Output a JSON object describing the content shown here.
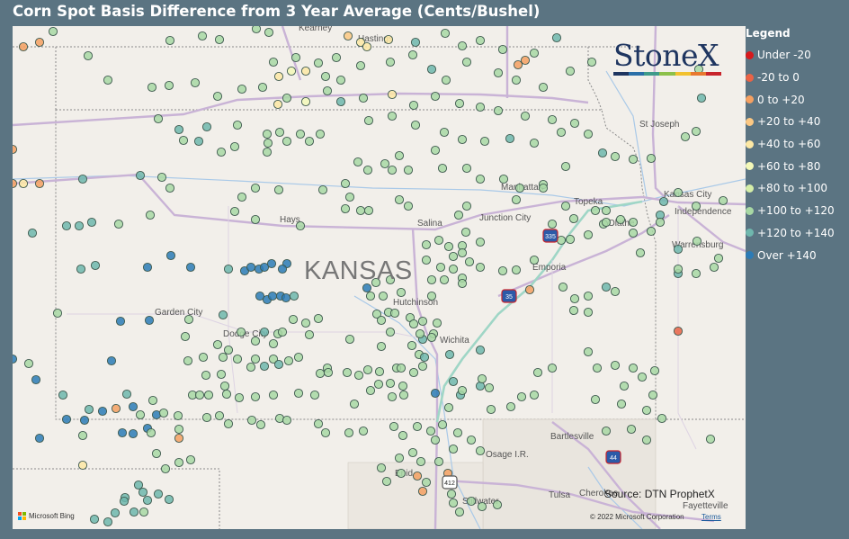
{
  "title": "Corn Spot Basis Difference from 3 Year Average (Cents/Bushel)",
  "map": {
    "state_label": "KANSAS",
    "source": "Source: DTN ProphetX",
    "copyright": "© 2022 Microsoft Corporation",
    "terms": "Terms",
    "bing": "Microsoft Bing",
    "logo": "StoneX",
    "logo_colors": [
      "#1e3560",
      "#2a6fa8",
      "#3f9b8a",
      "#8cc04a",
      "#f2c12e",
      "#e8782f",
      "#c8242c"
    ],
    "places": [
      "Kearney",
      "Hastings",
      "St Joseph",
      "Manhattan",
      "Topeka",
      "Kansas City",
      "Independence",
      "Hays",
      "Salina",
      "Junction City",
      "Olathe",
      "Warrensburg",
      "Emporia",
      "Garden City",
      "Hutchinson",
      "Dodge City",
      "Wichita",
      "Bartlesville",
      "Osage I.R.",
      "Enid",
      "Stillwater",
      "Tulsa",
      "Cherokee",
      "Fayetteville"
    ],
    "highway_shields": [
      "335",
      "35",
      "44",
      "412"
    ]
  },
  "legend": {
    "title": "Legend",
    "items": [
      {
        "label": "Under -20",
        "color": "#d7191c"
      },
      {
        "label": "-20 to 0",
        "color": "#ea6346"
      },
      {
        "label": "0 to +20",
        "color": "#f5a061"
      },
      {
        "label": "+20 to +40",
        "color": "#fcc883"
      },
      {
        "label": "+40 to +60",
        "color": "#fde8a4"
      },
      {
        "label": "+60 to +80",
        "color": "#f3f8b8"
      },
      {
        "label": "+80 to +100",
        "color": "#d5eea8"
      },
      {
        "label": "+100 to +120",
        "color": "#a8d8a4"
      },
      {
        "label": "+120 to +140",
        "color": "#6fb7ad"
      },
      {
        "label": "Over +140",
        "color": "#2c7bb6"
      }
    ]
  }
}
